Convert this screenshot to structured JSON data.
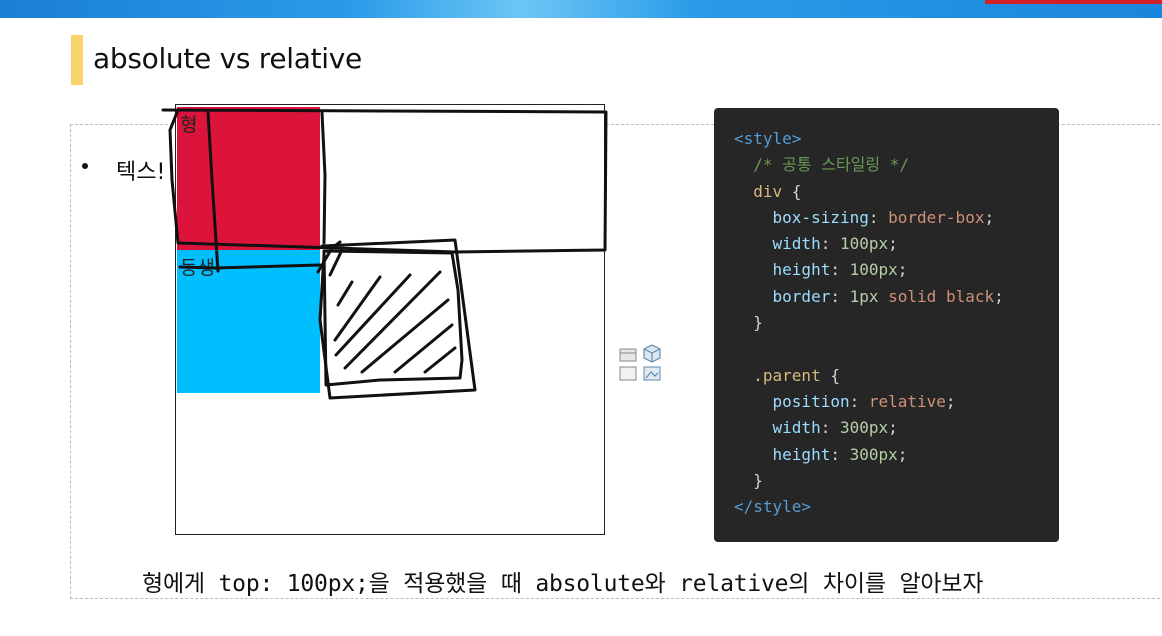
{
  "slide": {
    "title": "absolute vs relative",
    "bullet": "텍스!",
    "caption": "형에게 top: 100px;을 적용했을 때 absolute와 relative의 차이를 알아보자"
  },
  "demo": {
    "red_label": "형",
    "blue_label": "동생",
    "colors": {
      "red": "#dc143c",
      "blue": "#00bfff"
    }
  },
  "code": {
    "lines": [
      [
        [
          "c-tag",
          "<style>"
        ]
      ],
      [
        [
          "c-punct",
          "  "
        ],
        [
          "c-comment",
          "/* 공통 스타일링 */"
        ]
      ],
      [
        [
          "c-punct",
          "  "
        ],
        [
          "c-sel",
          "div"
        ],
        [
          "c-punct",
          " {"
        ]
      ],
      [
        [
          "c-punct",
          "    "
        ],
        [
          "c-prop",
          "box-sizing"
        ],
        [
          "c-punct",
          ": "
        ],
        [
          "c-val",
          "border-box"
        ],
        [
          "c-punct",
          ";"
        ]
      ],
      [
        [
          "c-punct",
          "    "
        ],
        [
          "c-prop",
          "width"
        ],
        [
          "c-punct",
          ": "
        ],
        [
          "c-num",
          "100px"
        ],
        [
          "c-punct",
          ";"
        ]
      ],
      [
        [
          "c-punct",
          "    "
        ],
        [
          "c-prop",
          "height"
        ],
        [
          "c-punct",
          ": "
        ],
        [
          "c-num",
          "100px"
        ],
        [
          "c-punct",
          ";"
        ]
      ],
      [
        [
          "c-punct",
          "    "
        ],
        [
          "c-prop",
          "border"
        ],
        [
          "c-punct",
          ": "
        ],
        [
          "c-num",
          "1px"
        ],
        [
          "c-punct",
          " "
        ],
        [
          "c-val",
          "solid black"
        ],
        [
          "c-punct",
          ";"
        ]
      ],
      [
        [
          "c-punct",
          "  }"
        ]
      ],
      [
        [
          "c-punct",
          ""
        ]
      ],
      [
        [
          "c-punct",
          "  "
        ],
        [
          "c-sel",
          ".parent"
        ],
        [
          "c-punct",
          " {"
        ]
      ],
      [
        [
          "c-punct",
          "    "
        ],
        [
          "c-prop",
          "position"
        ],
        [
          "c-punct",
          ": "
        ],
        [
          "c-val",
          "relative"
        ],
        [
          "c-punct",
          ";"
        ]
      ],
      [
        [
          "c-punct",
          "    "
        ],
        [
          "c-prop",
          "width"
        ],
        [
          "c-punct",
          ": "
        ],
        [
          "c-num",
          "300px"
        ],
        [
          "c-punct",
          ";"
        ]
      ],
      [
        [
          "c-punct",
          "    "
        ],
        [
          "c-prop",
          "height"
        ],
        [
          "c-punct",
          ": "
        ],
        [
          "c-num",
          "300px"
        ],
        [
          "c-punct",
          ";"
        ]
      ],
      [
        [
          "c-punct",
          "  }"
        ]
      ],
      [
        [
          "c-tag",
          "</style>"
        ]
      ]
    ]
  }
}
